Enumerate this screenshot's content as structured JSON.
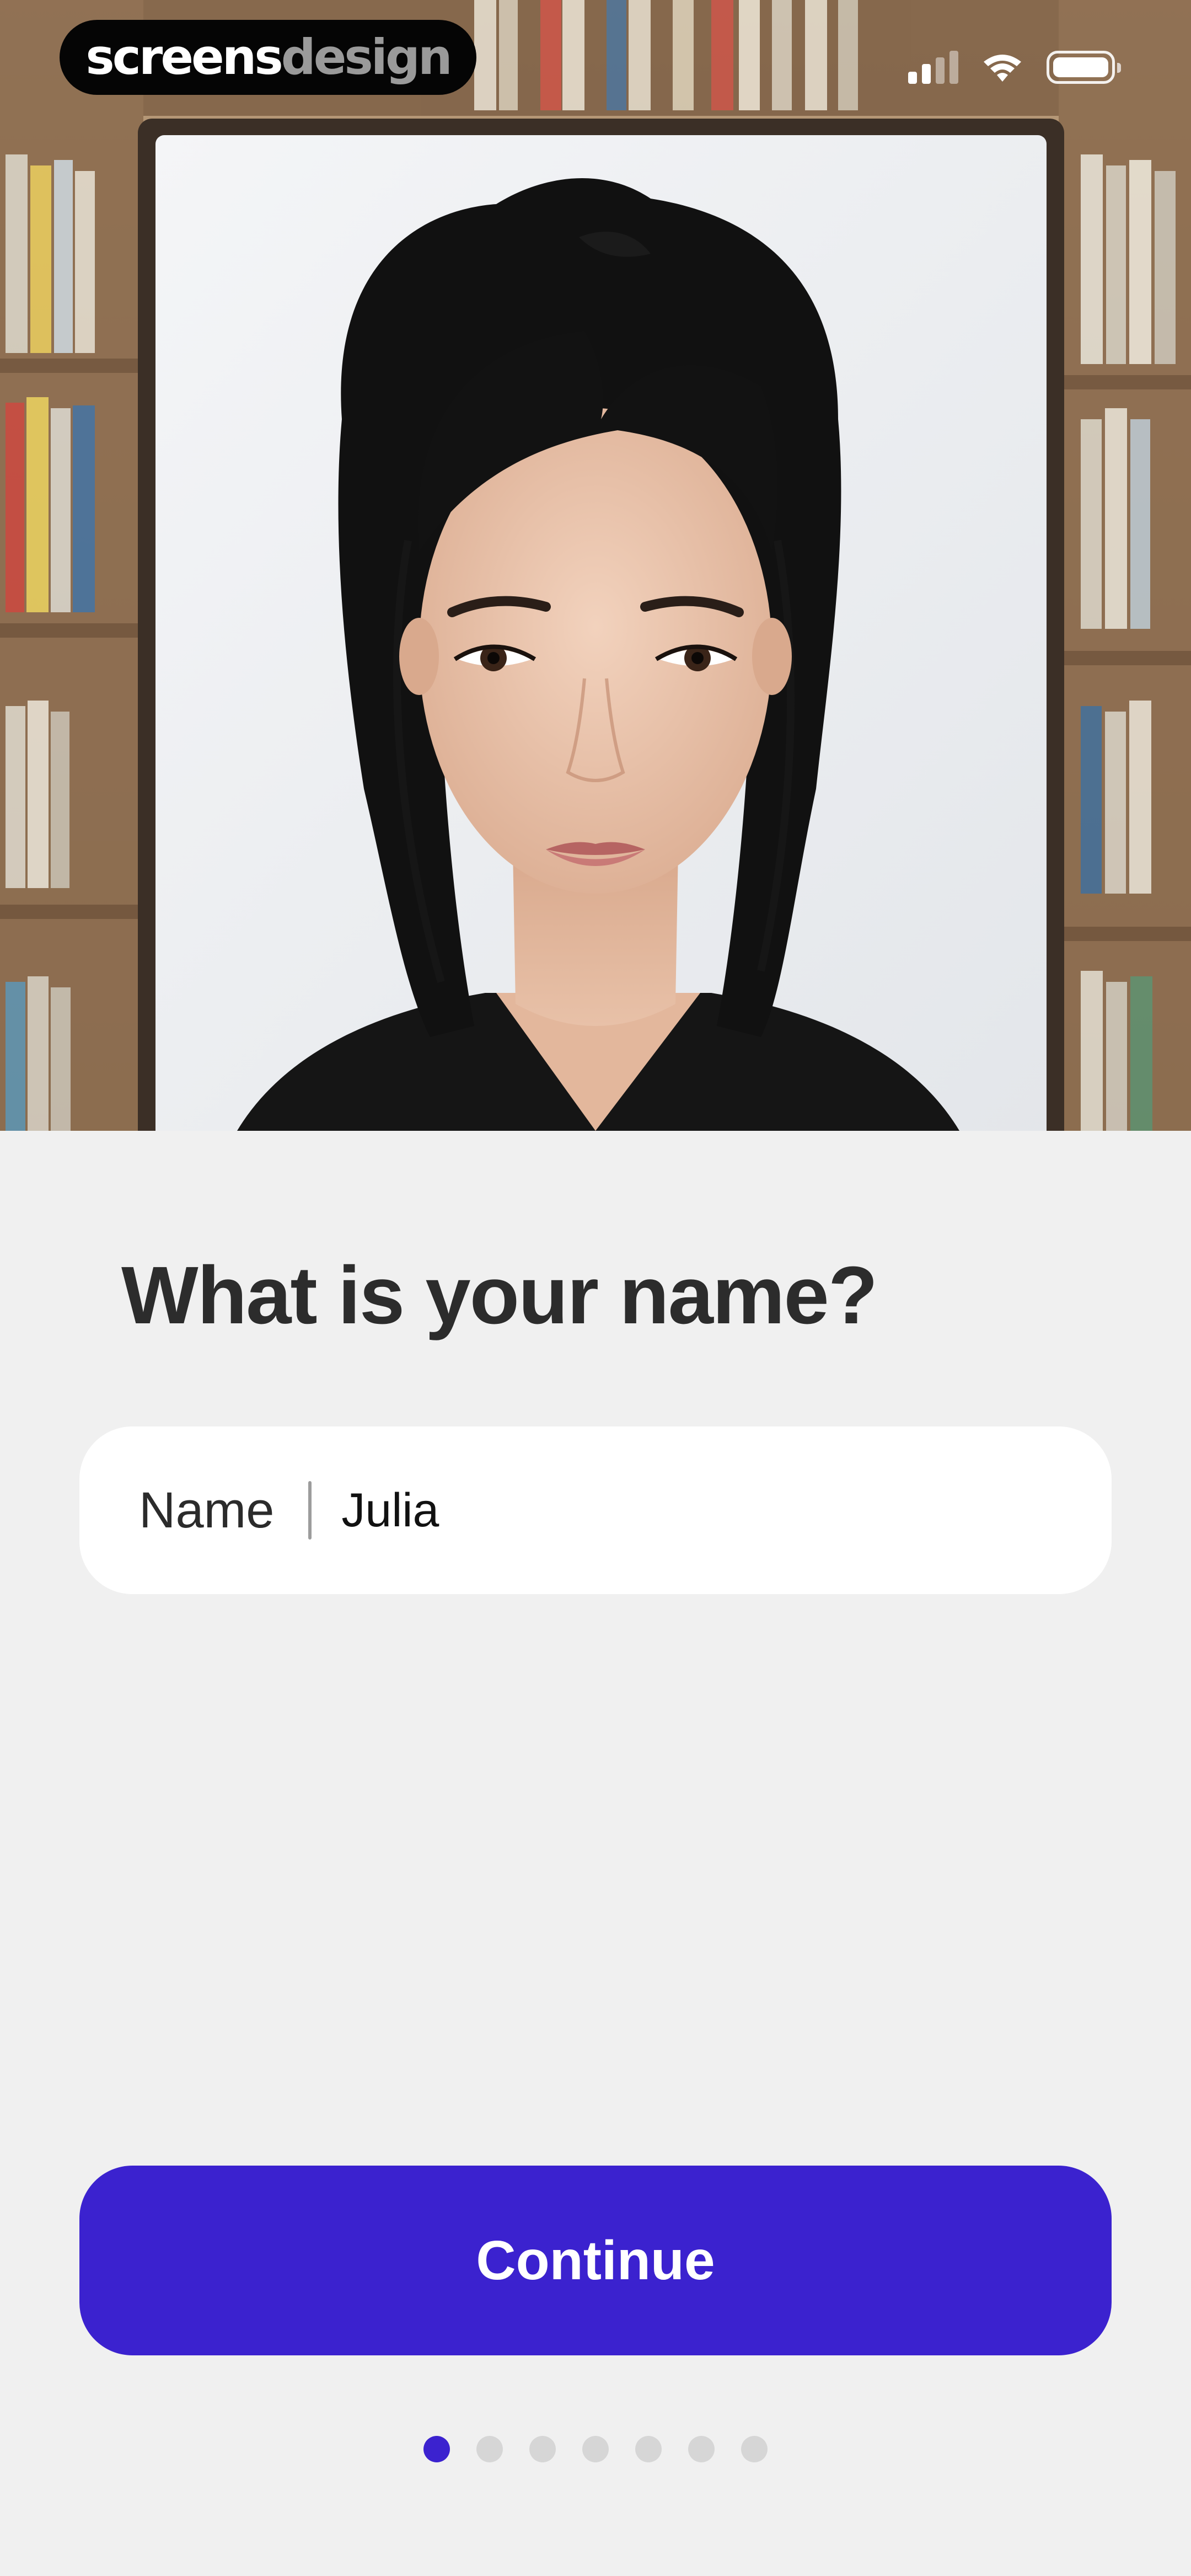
{
  "status_bar": {
    "brand_part1": "screens",
    "brand_part2": "design",
    "signal_icon": "signal-icon",
    "wifi_icon": "wifi-icon",
    "battery_icon": "battery-icon"
  },
  "hero": {
    "image": "portrait-photo"
  },
  "form": {
    "question": "What is your name?",
    "field_label": "Name",
    "field_value": "Julia"
  },
  "actions": {
    "continue_label": "Continue"
  },
  "pagination": {
    "total": 7,
    "current": 1
  },
  "colors": {
    "accent": "#3b22cf",
    "background": "#f0f0f0",
    "card": "#ffffff",
    "text": "#2c2c2c",
    "dot_inactive": "#d6d6d6"
  }
}
